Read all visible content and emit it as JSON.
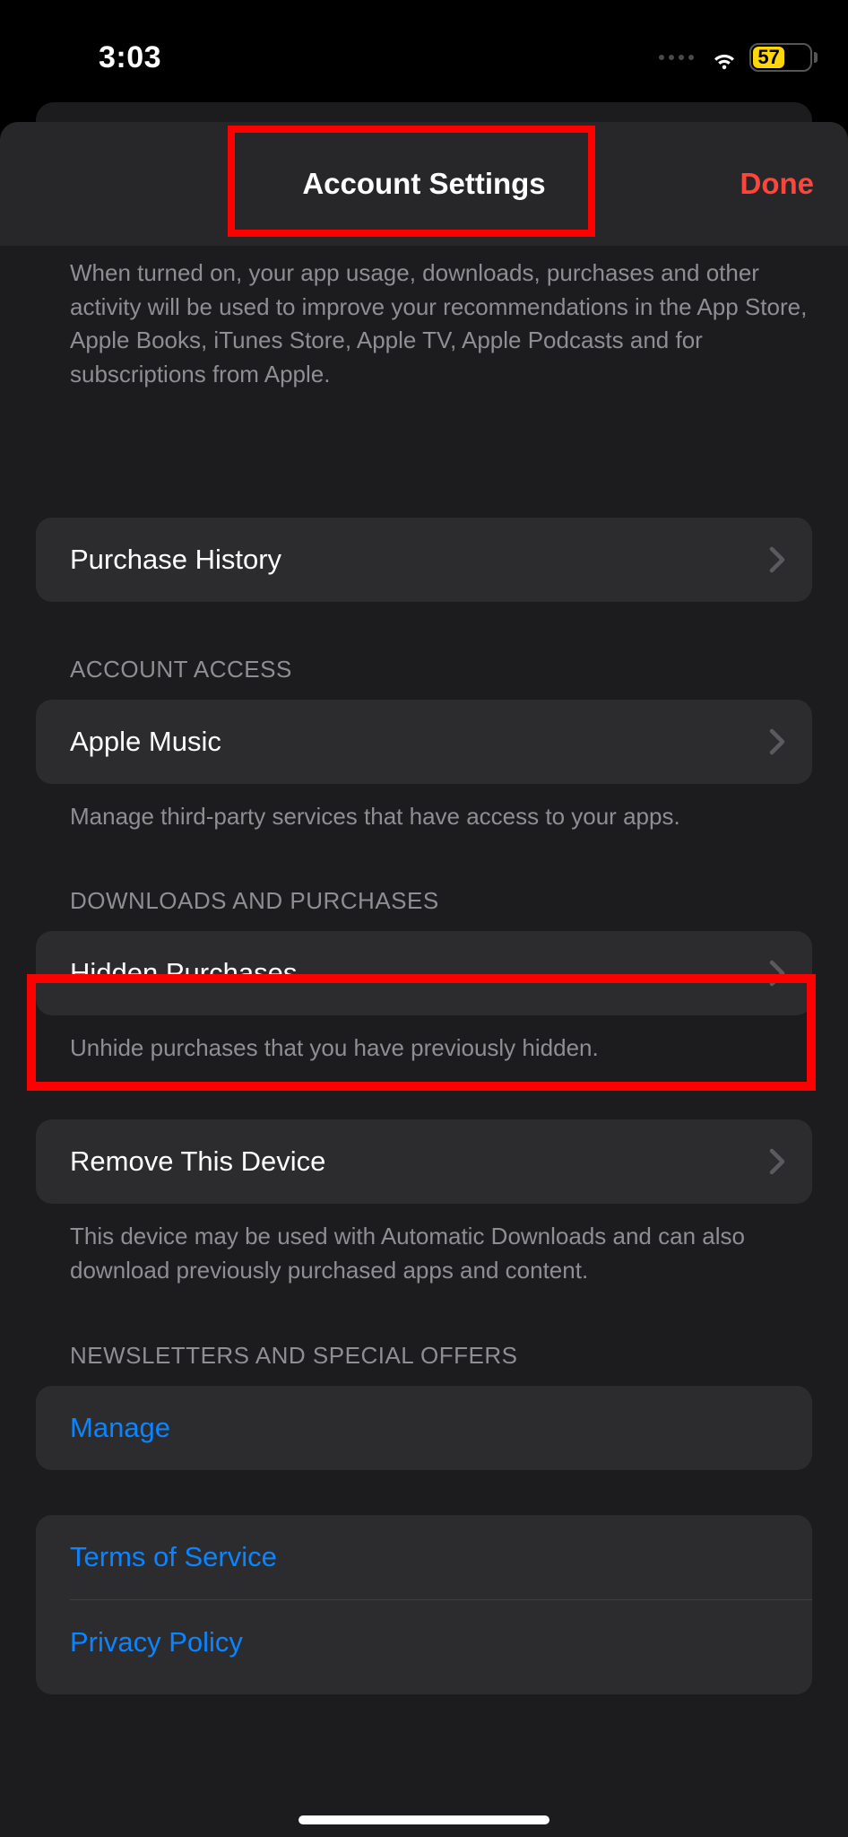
{
  "status_bar": {
    "time": "3:03",
    "battery": "57"
  },
  "header": {
    "title": "Account Settings",
    "done": "Done"
  },
  "intro_footer": "When turned on, your app usage, downloads, purchases and other activity will be used to improve your recommendations in the App Store, Apple Books, iTunes Store, Apple TV, Apple Podcasts and for subscriptions from Apple.",
  "purchase_history": {
    "label": "Purchase History"
  },
  "account_access": {
    "header": "ACCOUNT ACCESS",
    "apple_music": "Apple Music",
    "footer": "Manage third-party services that have access to your apps."
  },
  "downloads": {
    "header": "DOWNLOADS AND PURCHASES",
    "hidden": "Hidden Purchases",
    "hidden_footer": "Unhide purchases that you have previously hidden."
  },
  "remove_device": {
    "label": "Remove This Device",
    "footer": "This device may be used with Automatic Downloads and can also download previously purchased apps and content."
  },
  "newsletters": {
    "header": "NEWSLETTERS AND SPECIAL OFFERS",
    "manage": "Manage"
  },
  "legal": {
    "terms": "Terms of Service",
    "privacy": "Privacy Policy"
  }
}
